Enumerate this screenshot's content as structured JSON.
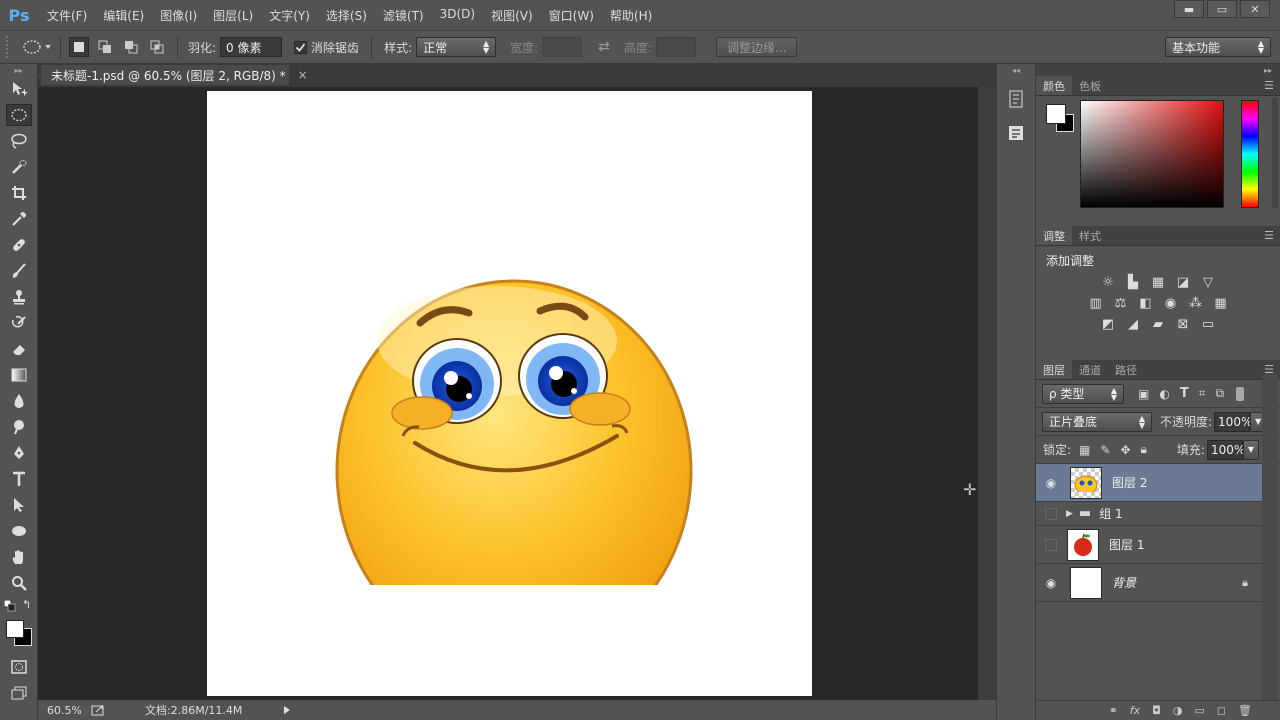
{
  "app": {
    "logo": "Ps"
  },
  "menu": [
    "文件(F)",
    "编辑(E)",
    "图像(I)",
    "图层(L)",
    "文字(Y)",
    "选择(S)",
    "滤镜(T)",
    "3D(D)",
    "视图(V)",
    "窗口(W)",
    "帮助(H)"
  ],
  "window_buttons": {
    "minimize": "▬",
    "restore": "▭",
    "close": "✕"
  },
  "options": {
    "feather_label": "羽化:",
    "feather_value": "0 像素",
    "antialias_label": "消除锯齿",
    "antialias_checked": true,
    "style_label": "样式:",
    "style_value": "正常",
    "width_label": "宽度:",
    "height_label": "高度:",
    "refine_edge": "调整边缘...",
    "workspace": "基本功能"
  },
  "document": {
    "tab_title": "未标题-1.psd @ 60.5% (图层 2, RGB/8) *",
    "tab_close": "×",
    "zoom": "60.5%",
    "doc_info": "文档:2.86M/11.4M"
  },
  "panels": {
    "color": {
      "tabs": [
        "颜色",
        "色板"
      ]
    },
    "adjustments": {
      "tabs": [
        "调整",
        "样式"
      ],
      "title": "添加调整"
    },
    "layers": {
      "tabs": [
        "图层",
        "通道",
        "路径"
      ],
      "filter_kind": "ρ 类型",
      "blend_mode": "正片叠底",
      "opacity_label": "不透明度:",
      "opacity_value": "100%",
      "lock_label": "锁定:",
      "fill_label": "填充:",
      "fill_value": "100%",
      "items": [
        {
          "name": "图层 2",
          "visible": true,
          "selected": true
        },
        {
          "name": "组 1",
          "visible": false,
          "group": true
        },
        {
          "name": "图层 1",
          "visible": false
        },
        {
          "name": "背景",
          "visible": true,
          "locked": true
        }
      ]
    }
  },
  "colors": {
    "accent": "#5ab3f0",
    "selected_layer": "#6a7a95",
    "foreground": "#ffffff",
    "background": "#000000"
  }
}
